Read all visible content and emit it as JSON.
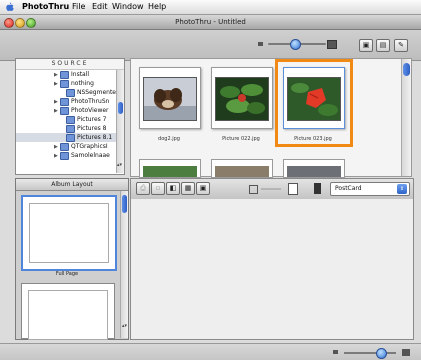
{
  "menubar": {
    "app_name": "PhotoThru",
    "items": [
      "File",
      "Edit",
      "Window",
      "Help"
    ]
  },
  "window": {
    "title": "PhotoThru - Untitled"
  },
  "source": {
    "header": "SOURCE",
    "items": [
      "Install",
      "nothing",
      "NSSegmentee",
      "PhotoThruSn",
      "PhotoViewer",
      "Pictures 7",
      "Pictures 8",
      "Pictures 8.1",
      "QTGraphicsI",
      "Samolelnaae"
    ]
  },
  "browser": {
    "thumbnails": [
      {
        "label": "dog2.jpg",
        "icon": "dog-photo"
      },
      {
        "label": "Picture 022.jpg",
        "icon": "leaves-photo"
      },
      {
        "label": "Picture 023.jpg",
        "icon": "red-leaf-photo",
        "selected": true
      }
    ]
  },
  "album": {
    "header": "Album Layout",
    "layouts": [
      {
        "label": "Full Page"
      }
    ]
  },
  "layout_select": {
    "value": "PostCard"
  },
  "colors": {
    "selection": "#f08a14",
    "folder": "#6f95d8",
    "scroll_thumb": "#3d6fd6"
  }
}
